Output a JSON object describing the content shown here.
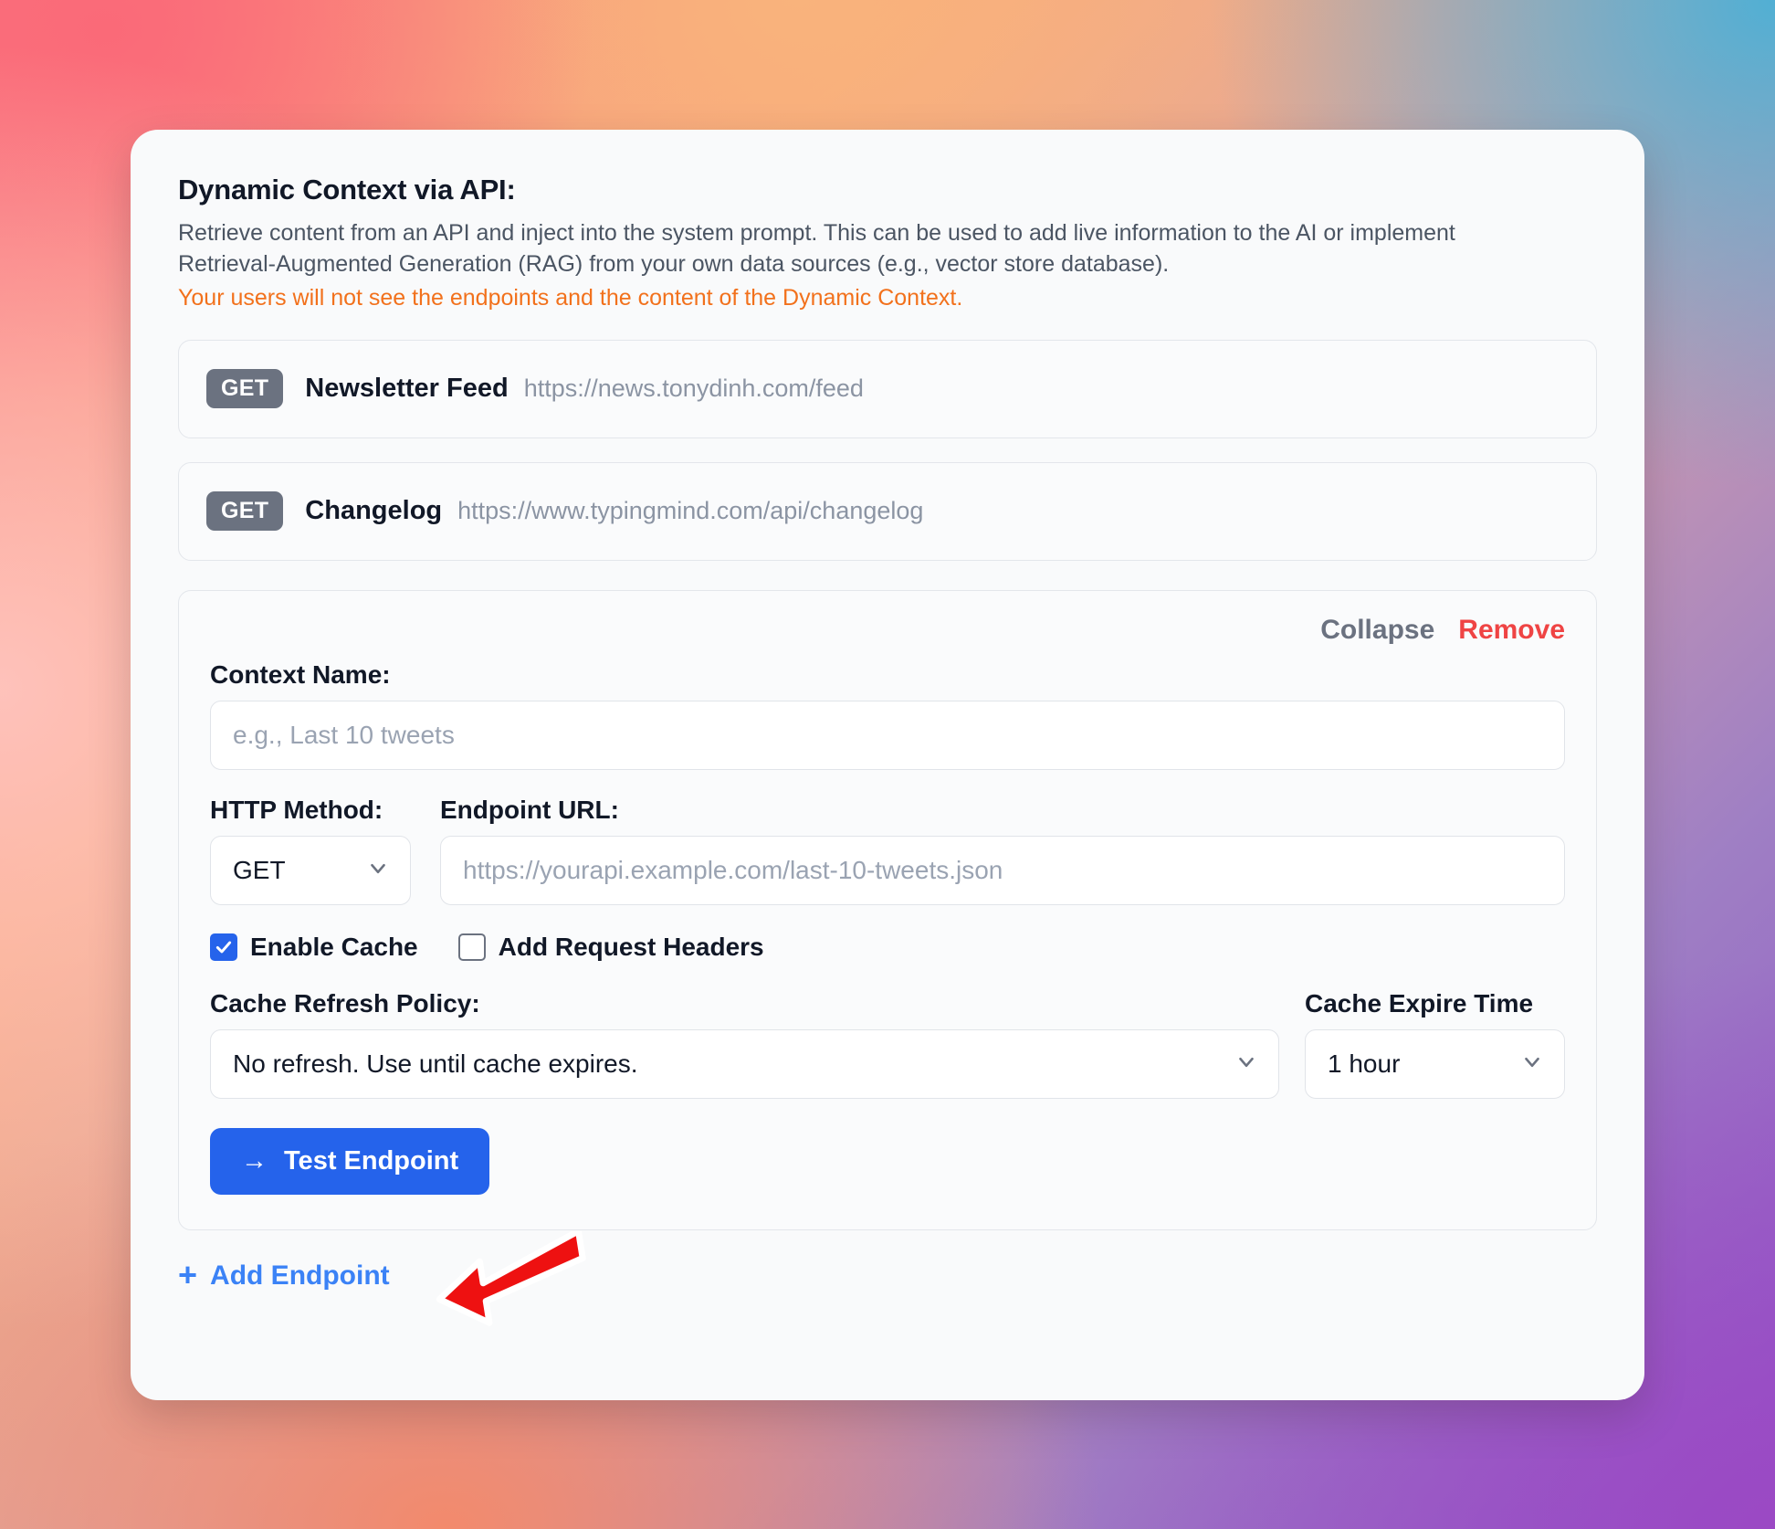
{
  "section": {
    "title": "Dynamic Context via API:",
    "description": "Retrieve content from an API and inject into the system prompt. This can be used to add live information to the AI or implement Retrieval-Augmented Generation (RAG) from your own data sources (e.g., vector store database).",
    "warning": "Your users will not see the endpoints and the content of the Dynamic Context."
  },
  "endpoints": [
    {
      "method": "GET",
      "name": "Newsletter Feed",
      "url": "https://news.tonydinh.com/feed"
    },
    {
      "method": "GET",
      "name": "Changelog",
      "url": "https://www.typingmind.com/api/changelog"
    }
  ],
  "editor": {
    "collapse_label": "Collapse",
    "remove_label": "Remove",
    "context_name_label": "Context Name:",
    "context_name_value": "",
    "context_name_placeholder": "e.g., Last 10 tweets",
    "http_method_label": "HTTP Method:",
    "http_method_value": "GET",
    "endpoint_url_label": "Endpoint URL:",
    "endpoint_url_value": "",
    "endpoint_url_placeholder": "https://yourapi.example.com/last-10-tweets.json",
    "enable_cache_label": "Enable Cache",
    "enable_cache_checked": true,
    "add_request_headers_label": "Add Request Headers",
    "add_request_headers_checked": false,
    "cache_refresh_policy_label": "Cache Refresh Policy:",
    "cache_refresh_policy_value": "No refresh. Use until cache expires.",
    "cache_expire_time_label": "Cache Expire Time",
    "cache_expire_time_value": "1 hour",
    "test_endpoint_label": "Test Endpoint",
    "test_endpoint_arrow": "→"
  },
  "footer": {
    "add_endpoint_label": "Add Endpoint",
    "add_endpoint_plus": "+"
  },
  "colors": {
    "accent_blue": "#2563eb",
    "link_blue": "#3b82f6",
    "warning_orange": "#f2711c",
    "remove_red": "#ef4444",
    "method_badge_gray": "#6b7280",
    "annotation_red": "#ee1111"
  }
}
